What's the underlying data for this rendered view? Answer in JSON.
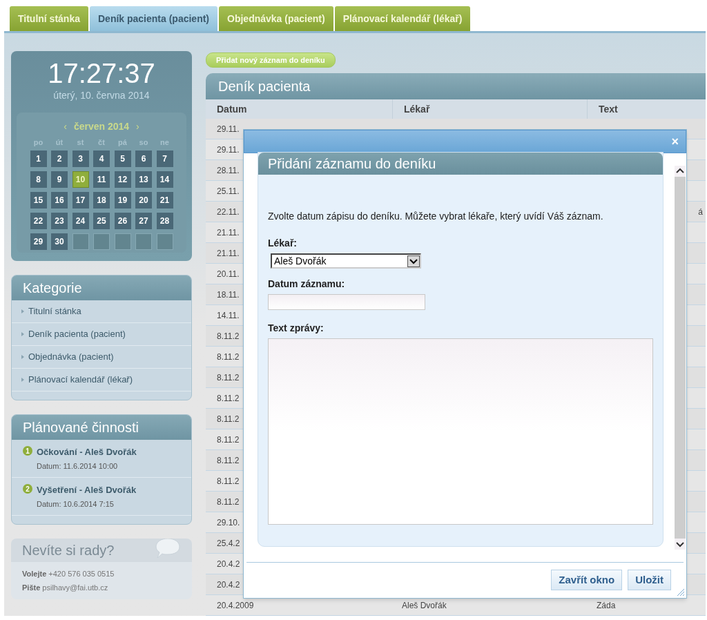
{
  "tabs": [
    {
      "label": "Titulní stánka",
      "selected": false
    },
    {
      "label": "Deník pacienta (pacient)",
      "selected": true
    },
    {
      "label": "Objednávka (pacient)",
      "selected": false
    },
    {
      "label": "Plánovací kalendář (lékař)",
      "selected": false
    }
  ],
  "clock": {
    "time": "17:27:37",
    "date": "úterý, 10. června 2014"
  },
  "calendar": {
    "prev": "‹",
    "month": "červen 2014",
    "next": "›",
    "weekdays": [
      "po",
      "út",
      "st",
      "čt",
      "pá",
      "so",
      "ne"
    ],
    "cells": [
      {
        "kind": "day",
        "label": "1",
        "selected": false
      },
      {
        "kind": "day",
        "label": "2",
        "selected": false
      },
      {
        "kind": "day",
        "label": "3",
        "selected": false
      },
      {
        "kind": "day",
        "label": "4",
        "selected": false
      },
      {
        "kind": "day",
        "label": "5",
        "selected": false
      },
      {
        "kind": "day",
        "label": "6",
        "selected": false
      },
      {
        "kind": "day",
        "label": "7",
        "selected": false
      },
      {
        "kind": "day",
        "label": "8",
        "selected": false
      },
      {
        "kind": "day",
        "label": "9",
        "selected": false
      },
      {
        "kind": "day",
        "label": "10",
        "selected": true
      },
      {
        "kind": "day",
        "label": "11",
        "selected": false
      },
      {
        "kind": "day",
        "label": "12",
        "selected": false
      },
      {
        "kind": "day",
        "label": "13",
        "selected": false
      },
      {
        "kind": "day",
        "label": "14",
        "selected": false
      },
      {
        "kind": "day",
        "label": "15",
        "selected": false
      },
      {
        "kind": "day",
        "label": "16",
        "selected": false
      },
      {
        "kind": "day",
        "label": "17",
        "selected": false
      },
      {
        "kind": "day",
        "label": "18",
        "selected": false
      },
      {
        "kind": "day",
        "label": "19",
        "selected": false
      },
      {
        "kind": "day",
        "label": "20",
        "selected": false
      },
      {
        "kind": "day",
        "label": "21",
        "selected": false
      },
      {
        "kind": "day",
        "label": "22",
        "selected": false
      },
      {
        "kind": "day",
        "label": "23",
        "selected": false
      },
      {
        "kind": "day",
        "label": "24",
        "selected": false
      },
      {
        "kind": "day",
        "label": "25",
        "selected": false
      },
      {
        "kind": "day",
        "label": "26",
        "selected": false
      },
      {
        "kind": "day",
        "label": "27",
        "selected": false
      },
      {
        "kind": "day",
        "label": "28",
        "selected": false
      },
      {
        "kind": "day",
        "label": "29",
        "selected": false
      },
      {
        "kind": "day",
        "label": "30",
        "selected": false
      },
      {
        "kind": "blank"
      },
      {
        "kind": "blank"
      },
      {
        "kind": "blank"
      },
      {
        "kind": "blank"
      },
      {
        "kind": "blank"
      }
    ]
  },
  "categories": {
    "title": "Kategorie",
    "items": [
      "Titulní stánka",
      "Deník pacienta (pacient)",
      "Objednávka (pacient)",
      "Plánovací kalendář (lékař)"
    ]
  },
  "planned": {
    "title": "Plánované činnosti",
    "items": [
      {
        "number": "1",
        "title": "Očkování - Aleš Dvořák",
        "date": "Datum: 11.6.2014 10:00"
      },
      {
        "number": "2",
        "title": "Vyšetření - Aleš Dvořák",
        "date": "Datum: 10.6.2014 7:15"
      }
    ]
  },
  "help": {
    "title": "Nevíte si rady?",
    "lines": [
      "**Volejte** +420 576 035 0515",
      "**Pište** psilhavy@fai.utb.cz"
    ]
  },
  "add_button": "Přidat nový záznam do deníku",
  "diary": {
    "title": "Deník pacienta",
    "columns": [
      "Datum",
      "Lékař",
      "Text"
    ],
    "rows": [
      {
        "date": "29.11."
      },
      {
        "date": "29.11."
      },
      {
        "date": "28.11."
      },
      {
        "date": "25.11."
      },
      {
        "date": "22.11.",
        "text": "á"
      },
      {
        "date": "21.11."
      },
      {
        "date": "21.11."
      },
      {
        "date": "20.11."
      },
      {
        "date": "18.11."
      },
      {
        "date": "14.11."
      },
      {
        "date": "8.11.2"
      },
      {
        "date": "8.11.2"
      },
      {
        "date": "8.11.2"
      },
      {
        "date": "8.11.2"
      },
      {
        "date": "8.11.2"
      },
      {
        "date": "8.11.2"
      },
      {
        "date": "8.11.2"
      },
      {
        "date": "8.11.2"
      },
      {
        "date": "8.11.2"
      },
      {
        "date": "29.10."
      },
      {
        "date": "25.4.2"
      },
      {
        "date": "20.4.2"
      },
      {
        "date": "20.4.2"
      },
      {
        "date": "20.4.2009",
        "doctor": "Aleš Dvořák",
        "text": "Záda"
      }
    ]
  },
  "dialog": {
    "close": "×",
    "heading": "Přidání záznamu do deníku",
    "intro": "Zvolte datum zápisu do deníku. Můžete vybrat lékaře, který uvídí Váš záznam.",
    "fields": [
      {
        "kind": "select",
        "label": "Lékař:",
        "value": "Aleš Dvořák"
      },
      {
        "kind": "text",
        "label": "Datum záznamu:"
      },
      {
        "kind": "textarea",
        "label": "Text zprávy:"
      }
    ],
    "buttons": [
      "Zavřít okno",
      "Uložit"
    ]
  }
}
